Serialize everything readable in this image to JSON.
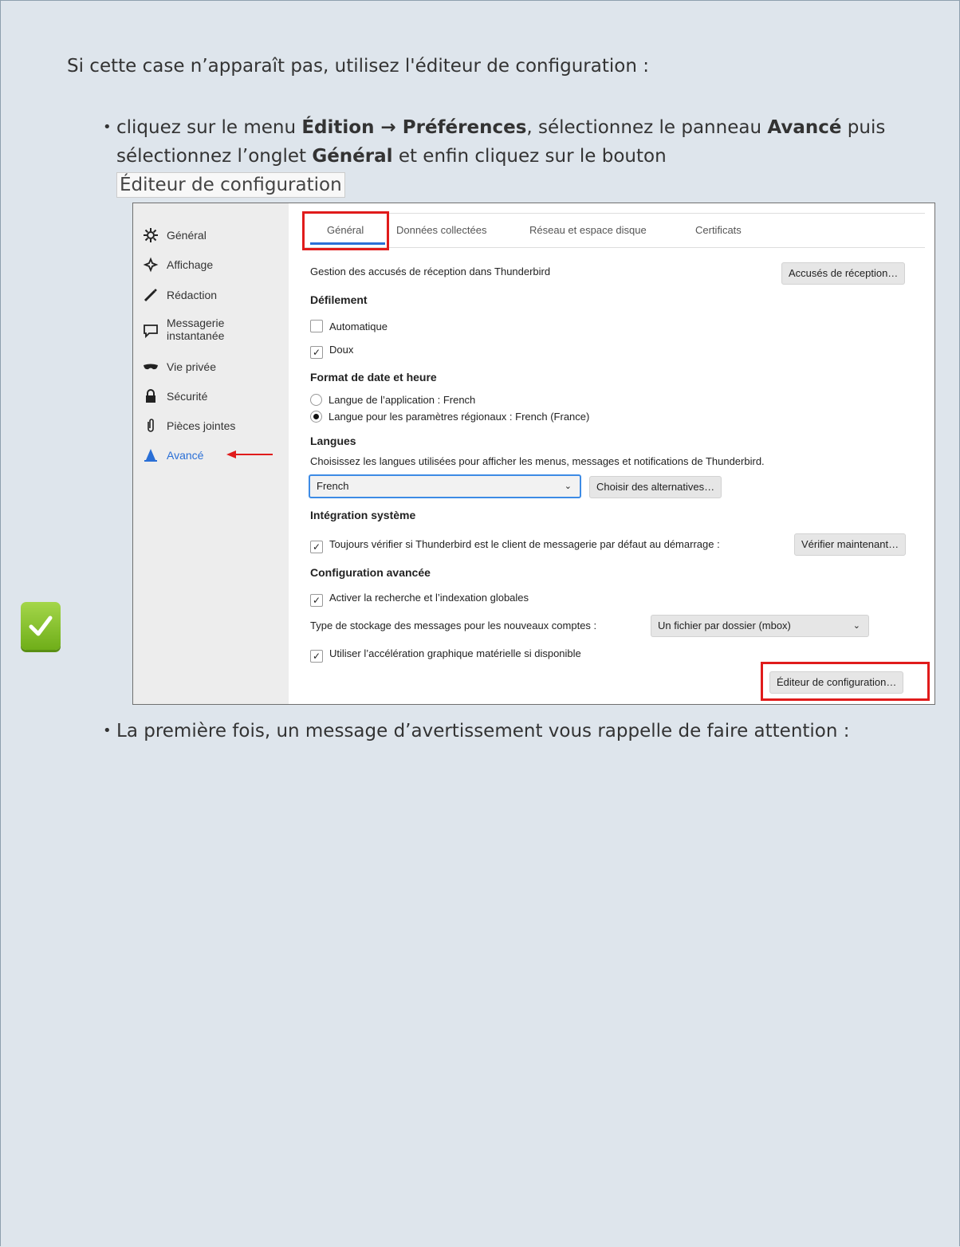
{
  "intro_text": "Si cette case n’apparaît pas, utilisez l'éditeur de configuration :",
  "bullet1": {
    "t1": "cliquez sur le menu ",
    "b1": "Édition → Préférences",
    "t2": ", sélectionnez le panneau ",
    "b2": "Avancé",
    "t3": " puis sélectionnez l’onglet ",
    "b3": "Général",
    "t4": " et enfin cliquez sur le bouton ",
    "button": "Éditeur de configuration"
  },
  "bullet2": "La première fois, un message d’avertissement vous rappelle de faire attention :",
  "screenshot": {
    "sidebar": [
      "Général",
      "Affichage",
      "Rédaction",
      "Messagerie instantanée",
      "Vie privée",
      "Sécurité",
      "Pièces jointes",
      "Avancé"
    ],
    "tabs": [
      "Général",
      "Données collectées",
      "Réseau et espace disque",
      "Certificats"
    ],
    "receipt_label": "Gestion des accusés de réception dans Thunderbird",
    "receipt_button": "Accusés de réception…",
    "scroll_heading": "Défilement",
    "auto_scroll": "Automatique",
    "smooth_scroll": "Doux",
    "date_heading": "Format de date et heure",
    "date_app": "Langue de l’application : French",
    "date_region": "Langue pour les paramètres régionaux : French (France)",
    "lang_heading": "Langues",
    "lang_desc": "Choisissez les langues utilisées pour afficher les menus, messages et notifications de Thunderbird.",
    "lang_select": "French",
    "lang_alt_button": "Choisir des alternatives…",
    "sys_heading": "Intégration système",
    "sys_check": "Toujours vérifier si Thunderbird est le client de messagerie par défaut au démarrage :",
    "sys_button": "Vérifier maintenant…",
    "adv_heading": "Configuration avancée",
    "adv_search": "Activer la recherche et l’indexation globales",
    "storage_label": "Type de stockage des messages pour les nouveaux comptes :",
    "storage_select": "Un fichier par dossier (mbox)",
    "hw_accel": "Utiliser l’accélération graphique matérielle si disponible",
    "config_button": "Éditeur de configuration…"
  },
  "colors": {
    "highlight": "#e01b1b",
    "accent": "#2a6fd6",
    "page_bg": "#dee5ec"
  }
}
